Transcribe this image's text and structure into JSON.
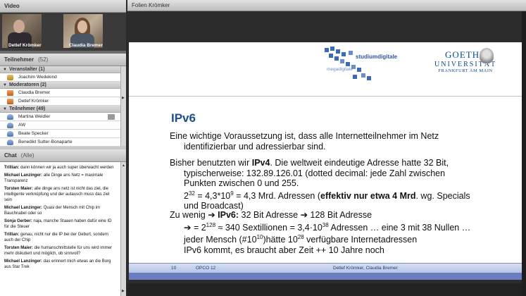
{
  "video": {
    "title": "Video",
    "cams": [
      {
        "name": "Detlef Krömker"
      },
      {
        "name": "Claudia Bremer"
      }
    ]
  },
  "participants": {
    "title": "Teilnehmer",
    "count": "(52)",
    "groups": [
      {
        "label": "Veranstalter (1)",
        "members": [
          "Joachim Wedekind"
        ]
      },
      {
        "label": "Moderatoren (2)",
        "members": [
          "Claudia Bremer",
          "Detlef Krömker"
        ]
      },
      {
        "label": "Teilnehmer (49)",
        "members": [
          "Martina Weidler",
          "AW",
          "Beate Specker",
          "Benedikt Sutter-Bonaparte"
        ]
      }
    ]
  },
  "chat": {
    "title": "Chat",
    "filter": "(Alle)",
    "messages": [
      {
        "who": "Trillian:",
        "text": "dann  können wir ja auch super überwacht werden"
      },
      {
        "who": "Michael Lanzinger:",
        "text": "alle Dinge ans Netz = maximale Transparenz"
      },
      {
        "who": "Torsten Maier:",
        "text": "alle dinge ans netz ist nicht das ziel, die intelligente verknüpfung und der autausch muss das ziel sein"
      },
      {
        "who": "Michael Lanzinger:",
        "text": "Quasi der Mensch mit Chip im Bauchnabel oder so"
      },
      {
        "who": "Sonja Gerber:",
        "text": "naja, manche Staaen haben dafür eine ID für die Steuer"
      },
      {
        "who": "Trillian:",
        "text": "genau, nicht nur die IP bei der Geburt, sondern auch der Chip"
      },
      {
        "who": "Torsten Maier:",
        "text": "die humanschnittstelle für uns wird immer mehr diskutiert und möglich, ob sinnvoll?"
      },
      {
        "who": "Michael Lanzinger:",
        "text": "das erinnert mich etwas an die Borg aus Star Trek"
      }
    ]
  },
  "slides_panel": {
    "title": "Folien Krömker"
  },
  "slide": {
    "logo_sd": "studiumdigitale",
    "logo_md": "megadigitale",
    "goethe_1": "GOETHE",
    "goethe_2": "UNIVERSITÄT",
    "goethe_3": "FRANKFURT AM MAIN",
    "title": "IPv6",
    "p1_l1": "Eine wichtige Voraussetzung ist, dass alle Internetteilnehmer im Netz",
    "p1_l2": "identifizierbar und adressierbar sind.",
    "p2_l1a": "Bisher benutzten wir ",
    "p2_l1b": "IPv4",
    "p2_l1c": ". Die weltweit eindeutige Adresse hatte 32 Bit,",
    "p2_l2": "typischerweise: 132.89.126.01 (dotted decimal: jede Zahl zwischen",
    "p2_l3": "Punkten zwischen 0 und 255.",
    "p2_l4a": "2",
    "p2_l4sup": "32",
    "p2_l4b": " = 4,3*10",
    "p2_l4sup2": "9",
    "p2_l4c": " = 4,3 Mrd. Adressen (",
    "p2_l4d": "effektiv nur etwa 4 Mrd",
    "p2_l4e": ". wg. Specials",
    "p2_l5": "und Broadcast)",
    "p3_l1a": "Zu wenig ➔ ",
    "p3_l1b": "IPv6:",
    "p3_l1c": "  32 Bit Adresse ➔ 128 Bit Adresse",
    "p3_l2a": "➔ = 2",
    "p3_l2sup": "128",
    "p3_l2b": "  ≈ 340 Sextillionen = 3,4·10",
    "p3_l2sup2": "38",
    "p3_l2c": " Adressen … eine 3 mit 38 Nullen …",
    "p3_l3a": "jeder Mensch (#10",
    "p3_l3sup": "10",
    "p3_l3b": ")hätte 10",
    "p3_l3sup2": "28",
    "p3_l3c": " verfügbare Internetadressen",
    "p3_l4": "IPv6 kommt, es braucht aber Zeit ++ 10 Jahre noch",
    "footer_num": "10",
    "footer_mid": "OPCO 12",
    "footer_auth": "Detlef Krömker, Claudia Bremer"
  }
}
